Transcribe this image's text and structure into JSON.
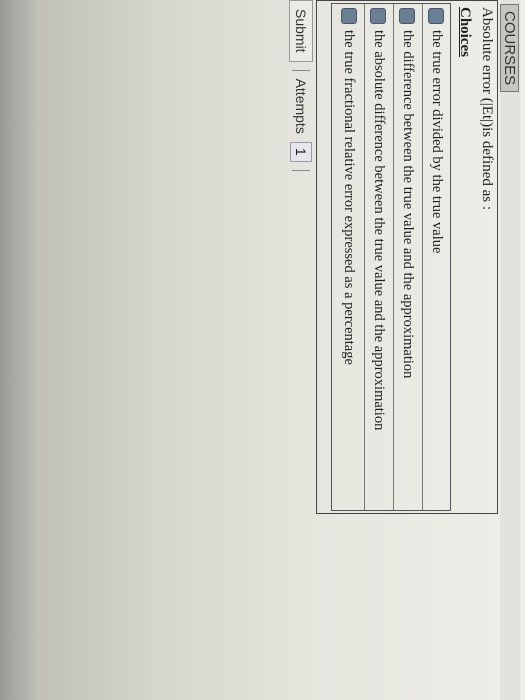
{
  "header": {
    "courses_label": "COURSES"
  },
  "question": {
    "text": "Absolute error (|Et|)is defined as :"
  },
  "choices": {
    "title": "Choices",
    "items": [
      {
        "label": "the true error divided by the true value"
      },
      {
        "label": "the difference between the true value and the approximation"
      },
      {
        "label": "the absolute difference between the true value and the approximation"
      },
      {
        "label": "the true fractional relative error expressed as a percentage"
      }
    ]
  },
  "footer": {
    "submit_label": "Submit",
    "attempts_label": "Attempts",
    "attempts_count": "1"
  }
}
